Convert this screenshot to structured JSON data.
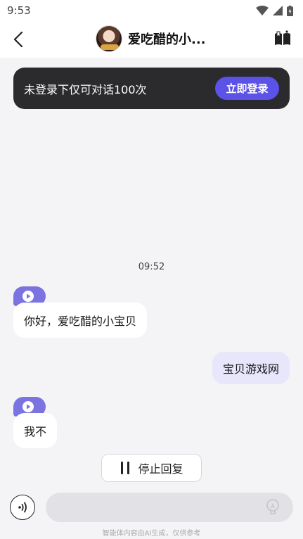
{
  "status": {
    "time": "9:53"
  },
  "header": {
    "title": "爱吃醋的小..."
  },
  "banner": {
    "text": "未登录下仅可对话100次",
    "login_label": "立即登录"
  },
  "chat": {
    "time": "09:52",
    "messages": [
      {
        "from": "bot",
        "text": "你好，爱吃醋的小宝贝"
      },
      {
        "from": "user",
        "text": "宝贝游戏网"
      },
      {
        "from": "bot",
        "text": "我不"
      }
    ]
  },
  "controls": {
    "stop_label": "停止回复"
  },
  "input": {
    "value": "",
    "placeholder": ""
  },
  "footer": {
    "disclaimer": "智能体内容由AI生成，仅供参考"
  },
  "colors": {
    "accent": "#5b52e8",
    "voice_tag": "#7b74e0",
    "user_bubble": "#e8e6fb",
    "banner_bg": "#2b2b2d"
  }
}
